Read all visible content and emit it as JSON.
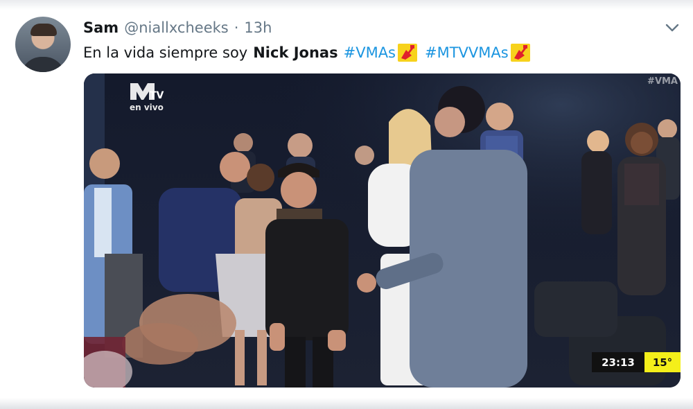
{
  "tweet": {
    "author_name": "Sam",
    "handle": "@niallxcheeks",
    "separator": "·",
    "time": "13h",
    "text_prefix": "En la vida siempre soy",
    "text_bold": "Nick Jonas",
    "hashtags": [
      "#VMAs",
      "#MTVVMAs"
    ]
  },
  "icons": {
    "menu": "chevron-down-icon",
    "hashtag_emoji": "vma-moonman-icon"
  },
  "media": {
    "channel_logo": "MTV",
    "live_label": "en vivo",
    "watermark": "#VMA",
    "clock": "23:13",
    "temperature": "15°"
  },
  "colors": {
    "hashtag": "#1b95e0",
    "text": "#14171a",
    "muted": "#657786",
    "temp_badge": "#f4ef1a"
  }
}
